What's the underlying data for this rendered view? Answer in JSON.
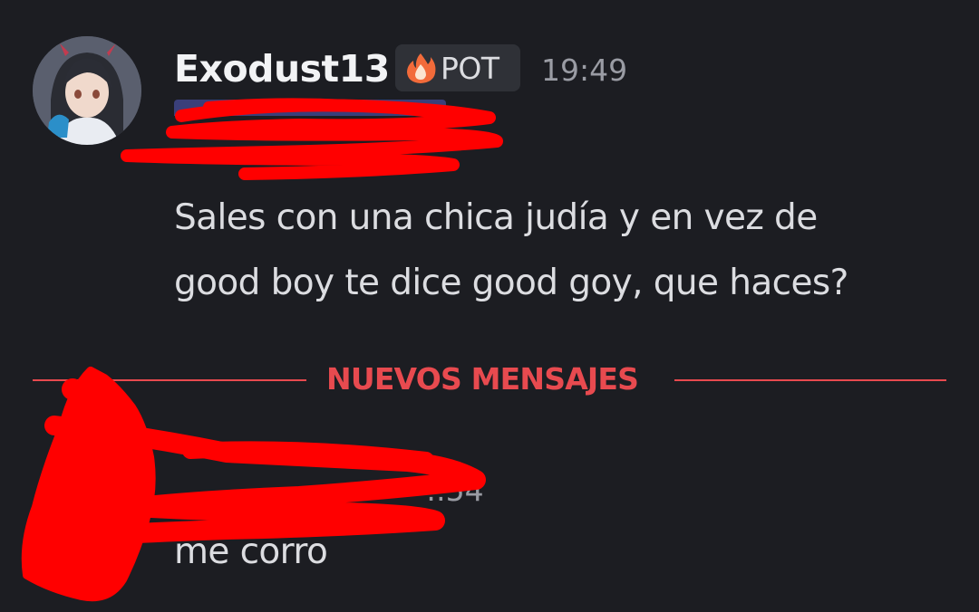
{
  "message1": {
    "username": "Exodust13",
    "tag_label": "POT",
    "tag_icon": "flame-icon",
    "timestamp": "19:49",
    "text_line1": "Sales con una chica judía y en vez de",
    "text_line2": "good boy te dice good goy, que haces?"
  },
  "divider": {
    "label": "NUEVOS MENSAJES",
    "color": "#e84a4f"
  },
  "message2": {
    "timestamp_visible": ":.54",
    "text": "me corro"
  },
  "colors": {
    "background": "#1c1d22",
    "text": "#dcdde1",
    "username": "#f2f3f5",
    "muted": "#9a9ca4",
    "redaction": "#ff0000"
  }
}
